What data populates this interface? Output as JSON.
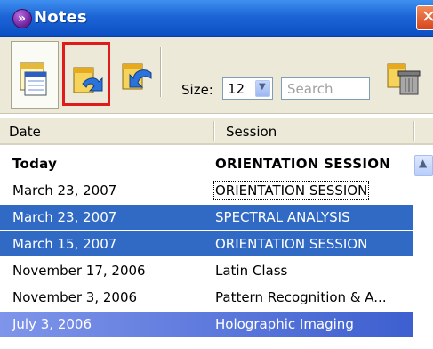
{
  "window": {
    "title": "Notes"
  },
  "toolbar": {
    "size_label": "Size:",
    "size_value": "12",
    "search_placeholder": "Search"
  },
  "columns": {
    "date": "Date",
    "session": "Session"
  },
  "rows": [
    {
      "date": "Today",
      "session": "ORIENTATION SESSION"
    },
    {
      "date": "March 23, 2007",
      "session": "ORIENTATION SESSION"
    },
    {
      "date": "March 23, 2007",
      "session": "SPECTRAL ANALYSIS"
    },
    {
      "date": "March 15, 2007",
      "session": "ORIENTATION SESSION"
    },
    {
      "date": "November 17, 2006",
      "session": "Latin Class"
    },
    {
      "date": "November 3, 2006",
      "session": "Pattern Recognition & A..."
    },
    {
      "date": "July 3, 2006",
      "session": "Holographic Imaging"
    }
  ],
  "colors": {
    "titlebar": "#1d66d6",
    "selection": "#316ac5",
    "highlight_box": "#e01b1b"
  }
}
